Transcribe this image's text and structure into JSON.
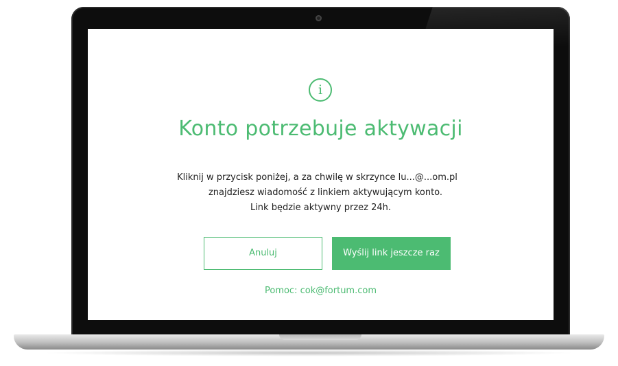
{
  "dialog": {
    "icon": "info-icon",
    "icon_glyph": "i",
    "title": "Konto potrzebuje aktywacji",
    "message_lines": [
      "Kliknij w przycisk poniżej, a za chwilę w skrzynce lu...@...om.pl",
      "znajdziesz wiadomość z linkiem aktywującym konto.",
      "Link będzie aktywny przez 24h."
    ],
    "cancel_label": "Anuluj",
    "resend_label": "Wyślij link jeszcze raz",
    "help_text": "Pomoc: cok@fortum.com"
  },
  "colors": {
    "accent": "#4cbb72",
    "text": "#222222",
    "bezel": "#0d0d0d"
  }
}
